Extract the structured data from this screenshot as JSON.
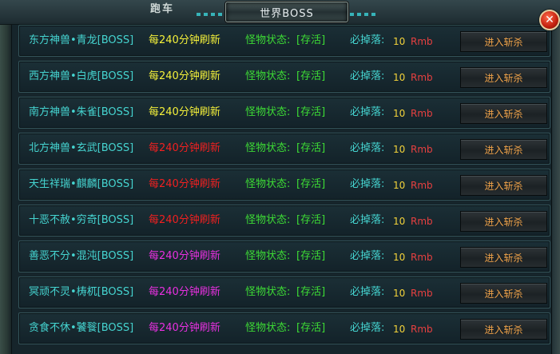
{
  "header": {
    "title": "世界BOSS",
    "left_partial_text": "跑车",
    "close_symbol": "✕"
  },
  "colors": {
    "yellow": "#f4f03a",
    "red": "#f02020",
    "magenta": "#e830e0"
  },
  "rows": [
    {
      "name": "东方神兽•青龙[BOSS]",
      "refresh": "每240分钟刷新",
      "refresh_color": "yellow",
      "status_label": "怪物状态:",
      "status_value": "[存活]",
      "drop_label": "必掉落:",
      "drop_amount": "10",
      "drop_unit": "Rmb",
      "button": "进入斩杀"
    },
    {
      "name": "西方神兽•白虎[BOSS]",
      "refresh": "每240分钟刷新",
      "refresh_color": "yellow",
      "status_label": "怪物状态:",
      "status_value": "[存活]",
      "drop_label": "必掉落:",
      "drop_amount": "10",
      "drop_unit": "Rmb",
      "button": "进入斩杀"
    },
    {
      "name": "南方神兽•朱雀[BOSS]",
      "refresh": "每240分钟刷新",
      "refresh_color": "yellow",
      "status_label": "怪物状态:",
      "status_value": "[存活]",
      "drop_label": "必掉落:",
      "drop_amount": "10",
      "drop_unit": "Rmb",
      "button": "进入斩杀"
    },
    {
      "name": "北方神兽•玄武[BOSS]",
      "refresh": "每240分钟刷新",
      "refresh_color": "red",
      "status_label": "怪物状态:",
      "status_value": "[存活]",
      "drop_label": "必掉落:",
      "drop_amount": "10",
      "drop_unit": "Rmb",
      "button": "进入斩杀"
    },
    {
      "name": "天生祥瑞•麒麟[BOSS]",
      "refresh": "每240分钟刷新",
      "refresh_color": "red",
      "status_label": "怪物状态:",
      "status_value": "[存活]",
      "drop_label": "必掉落:",
      "drop_amount": "10",
      "drop_unit": "Rmb",
      "button": "进入斩杀"
    },
    {
      "name": "十恶不赦•穷奇[BOSS]",
      "refresh": "每240分钟刷新",
      "refresh_color": "red",
      "status_label": "怪物状态:",
      "status_value": "[存活]",
      "drop_label": "必掉落:",
      "drop_amount": "10",
      "drop_unit": "Rmb",
      "button": "进入斩杀"
    },
    {
      "name": "善恶不分•混沌[BOSS]",
      "refresh": "每240分钟刷新",
      "refresh_color": "magenta",
      "status_label": "怪物状态:",
      "status_value": "[存活]",
      "drop_label": "必掉落:",
      "drop_amount": "10",
      "drop_unit": "Rmb",
      "button": "进入斩杀"
    },
    {
      "name": "冥顽不灵•梼杌[BOSS]",
      "refresh": "每240分钟刷新",
      "refresh_color": "magenta",
      "status_label": "怪物状态:",
      "status_value": "[存活]",
      "drop_label": "必掉落:",
      "drop_amount": "10",
      "drop_unit": "Rmb",
      "button": "进入斩杀"
    },
    {
      "name": "贪食不休•饕餮[BOSS]",
      "refresh": "每240分钟刷新",
      "refresh_color": "magenta",
      "status_label": "怪物状态:",
      "status_value": "[存活]",
      "drop_label": "必掉落:",
      "drop_amount": "10",
      "drop_unit": "Rmb",
      "button": "进入斩杀"
    }
  ]
}
